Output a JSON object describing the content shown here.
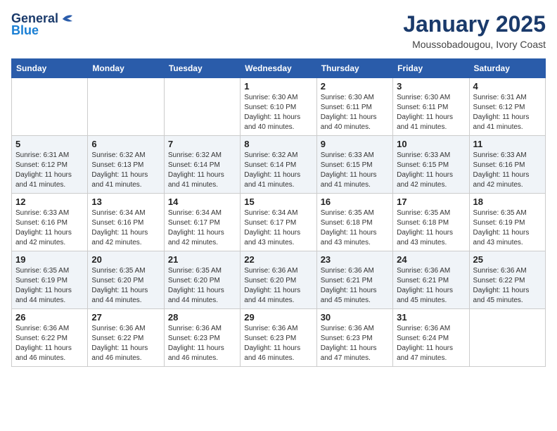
{
  "header": {
    "logo_general": "General",
    "logo_blue": "Blue",
    "month": "January 2025",
    "location": "Moussobadougou, Ivory Coast"
  },
  "weekdays": [
    "Sunday",
    "Monday",
    "Tuesday",
    "Wednesday",
    "Thursday",
    "Friday",
    "Saturday"
  ],
  "weeks": [
    [
      {
        "day": "",
        "sunrise": "",
        "sunset": "",
        "daylight": ""
      },
      {
        "day": "",
        "sunrise": "",
        "sunset": "",
        "daylight": ""
      },
      {
        "day": "",
        "sunrise": "",
        "sunset": "",
        "daylight": ""
      },
      {
        "day": "1",
        "sunrise": "Sunrise: 6:30 AM",
        "sunset": "Sunset: 6:10 PM",
        "daylight": "Daylight: 11 hours and 40 minutes."
      },
      {
        "day": "2",
        "sunrise": "Sunrise: 6:30 AM",
        "sunset": "Sunset: 6:11 PM",
        "daylight": "Daylight: 11 hours and 40 minutes."
      },
      {
        "day": "3",
        "sunrise": "Sunrise: 6:30 AM",
        "sunset": "Sunset: 6:11 PM",
        "daylight": "Daylight: 11 hours and 41 minutes."
      },
      {
        "day": "4",
        "sunrise": "Sunrise: 6:31 AM",
        "sunset": "Sunset: 6:12 PM",
        "daylight": "Daylight: 11 hours and 41 minutes."
      }
    ],
    [
      {
        "day": "5",
        "sunrise": "Sunrise: 6:31 AM",
        "sunset": "Sunset: 6:12 PM",
        "daylight": "Daylight: 11 hours and 41 minutes."
      },
      {
        "day": "6",
        "sunrise": "Sunrise: 6:32 AM",
        "sunset": "Sunset: 6:13 PM",
        "daylight": "Daylight: 11 hours and 41 minutes."
      },
      {
        "day": "7",
        "sunrise": "Sunrise: 6:32 AM",
        "sunset": "Sunset: 6:14 PM",
        "daylight": "Daylight: 11 hours and 41 minutes."
      },
      {
        "day": "8",
        "sunrise": "Sunrise: 6:32 AM",
        "sunset": "Sunset: 6:14 PM",
        "daylight": "Daylight: 11 hours and 41 minutes."
      },
      {
        "day": "9",
        "sunrise": "Sunrise: 6:33 AM",
        "sunset": "Sunset: 6:15 PM",
        "daylight": "Daylight: 11 hours and 41 minutes."
      },
      {
        "day": "10",
        "sunrise": "Sunrise: 6:33 AM",
        "sunset": "Sunset: 6:15 PM",
        "daylight": "Daylight: 11 hours and 42 minutes."
      },
      {
        "day": "11",
        "sunrise": "Sunrise: 6:33 AM",
        "sunset": "Sunset: 6:16 PM",
        "daylight": "Daylight: 11 hours and 42 minutes."
      }
    ],
    [
      {
        "day": "12",
        "sunrise": "Sunrise: 6:33 AM",
        "sunset": "Sunset: 6:16 PM",
        "daylight": "Daylight: 11 hours and 42 minutes."
      },
      {
        "day": "13",
        "sunrise": "Sunrise: 6:34 AM",
        "sunset": "Sunset: 6:16 PM",
        "daylight": "Daylight: 11 hours and 42 minutes."
      },
      {
        "day": "14",
        "sunrise": "Sunrise: 6:34 AM",
        "sunset": "Sunset: 6:17 PM",
        "daylight": "Daylight: 11 hours and 42 minutes."
      },
      {
        "day": "15",
        "sunrise": "Sunrise: 6:34 AM",
        "sunset": "Sunset: 6:17 PM",
        "daylight": "Daylight: 11 hours and 43 minutes."
      },
      {
        "day": "16",
        "sunrise": "Sunrise: 6:35 AM",
        "sunset": "Sunset: 6:18 PM",
        "daylight": "Daylight: 11 hours and 43 minutes."
      },
      {
        "day": "17",
        "sunrise": "Sunrise: 6:35 AM",
        "sunset": "Sunset: 6:18 PM",
        "daylight": "Daylight: 11 hours and 43 minutes."
      },
      {
        "day": "18",
        "sunrise": "Sunrise: 6:35 AM",
        "sunset": "Sunset: 6:19 PM",
        "daylight": "Daylight: 11 hours and 43 minutes."
      }
    ],
    [
      {
        "day": "19",
        "sunrise": "Sunrise: 6:35 AM",
        "sunset": "Sunset: 6:19 PM",
        "daylight": "Daylight: 11 hours and 44 minutes."
      },
      {
        "day": "20",
        "sunrise": "Sunrise: 6:35 AM",
        "sunset": "Sunset: 6:20 PM",
        "daylight": "Daylight: 11 hours and 44 minutes."
      },
      {
        "day": "21",
        "sunrise": "Sunrise: 6:35 AM",
        "sunset": "Sunset: 6:20 PM",
        "daylight": "Daylight: 11 hours and 44 minutes."
      },
      {
        "day": "22",
        "sunrise": "Sunrise: 6:36 AM",
        "sunset": "Sunset: 6:20 PM",
        "daylight": "Daylight: 11 hours and 44 minutes."
      },
      {
        "day": "23",
        "sunrise": "Sunrise: 6:36 AM",
        "sunset": "Sunset: 6:21 PM",
        "daylight": "Daylight: 11 hours and 45 minutes."
      },
      {
        "day": "24",
        "sunrise": "Sunrise: 6:36 AM",
        "sunset": "Sunset: 6:21 PM",
        "daylight": "Daylight: 11 hours and 45 minutes."
      },
      {
        "day": "25",
        "sunrise": "Sunrise: 6:36 AM",
        "sunset": "Sunset: 6:22 PM",
        "daylight": "Daylight: 11 hours and 45 minutes."
      }
    ],
    [
      {
        "day": "26",
        "sunrise": "Sunrise: 6:36 AM",
        "sunset": "Sunset: 6:22 PM",
        "daylight": "Daylight: 11 hours and 46 minutes."
      },
      {
        "day": "27",
        "sunrise": "Sunrise: 6:36 AM",
        "sunset": "Sunset: 6:22 PM",
        "daylight": "Daylight: 11 hours and 46 minutes."
      },
      {
        "day": "28",
        "sunrise": "Sunrise: 6:36 AM",
        "sunset": "Sunset: 6:23 PM",
        "daylight": "Daylight: 11 hours and 46 minutes."
      },
      {
        "day": "29",
        "sunrise": "Sunrise: 6:36 AM",
        "sunset": "Sunset: 6:23 PM",
        "daylight": "Daylight: 11 hours and 46 minutes."
      },
      {
        "day": "30",
        "sunrise": "Sunrise: 6:36 AM",
        "sunset": "Sunset: 6:23 PM",
        "daylight": "Daylight: 11 hours and 47 minutes."
      },
      {
        "day": "31",
        "sunrise": "Sunrise: 6:36 AM",
        "sunset": "Sunset: 6:24 PM",
        "daylight": "Daylight: 11 hours and 47 minutes."
      },
      {
        "day": "",
        "sunrise": "",
        "sunset": "",
        "daylight": ""
      }
    ]
  ]
}
